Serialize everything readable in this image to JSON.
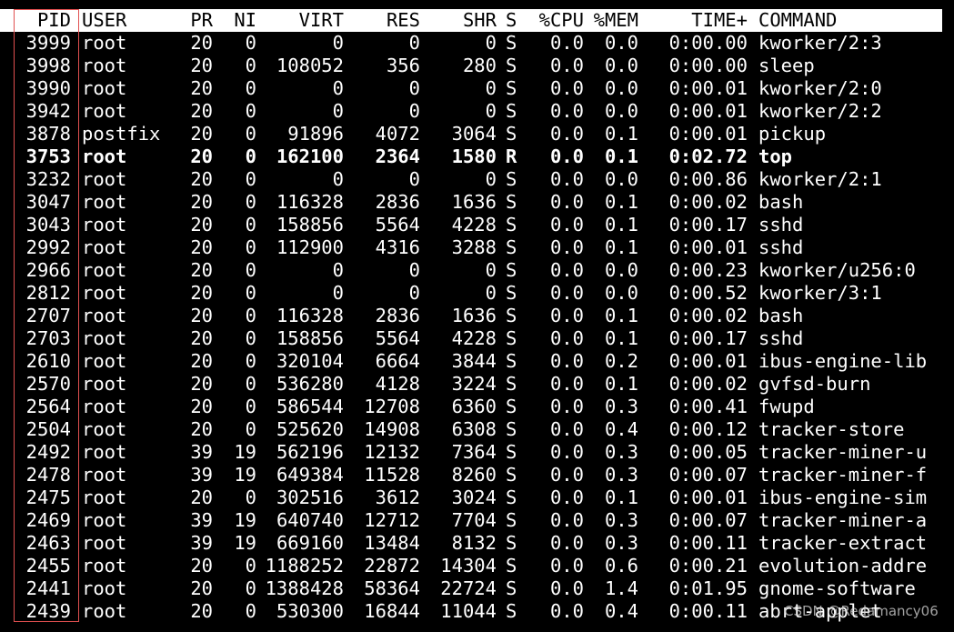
{
  "colors": {
    "background": "#000000",
    "foreground": "#ffffff",
    "header_background": "#ffffff",
    "header_foreground": "#000000",
    "highlight_border": "#e05050"
  },
  "header": {
    "pid": "PID",
    "user": "USER",
    "pr": "PR",
    "ni": "NI",
    "virt": "VIRT",
    "res": "RES",
    "shr": "SHR",
    "s": "S",
    "cpu": "%CPU",
    "mem": "%MEM",
    "time": "TIME+",
    "command": "COMMAND"
  },
  "processes": [
    {
      "pid": "3999",
      "user": "root",
      "pr": "20",
      "ni": "0",
      "virt": "0",
      "res": "0",
      "shr": "0",
      "s": "S",
      "cpu": "0.0",
      "mem": "0.0",
      "time": "0:00.00",
      "command": "kworker/2:3"
    },
    {
      "pid": "3998",
      "user": "root",
      "pr": "20",
      "ni": "0",
      "virt": "108052",
      "res": "356",
      "shr": "280",
      "s": "S",
      "cpu": "0.0",
      "mem": "0.0",
      "time": "0:00.00",
      "command": "sleep"
    },
    {
      "pid": "3990",
      "user": "root",
      "pr": "20",
      "ni": "0",
      "virt": "0",
      "res": "0",
      "shr": "0",
      "s": "S",
      "cpu": "0.0",
      "mem": "0.0",
      "time": "0:00.01",
      "command": "kworker/2:0"
    },
    {
      "pid": "3942",
      "user": "root",
      "pr": "20",
      "ni": "0",
      "virt": "0",
      "res": "0",
      "shr": "0",
      "s": "S",
      "cpu": "0.0",
      "mem": "0.0",
      "time": "0:00.01",
      "command": "kworker/2:2"
    },
    {
      "pid": "3878",
      "user": "postfix",
      "pr": "20",
      "ni": "0",
      "virt": "91896",
      "res": "4072",
      "shr": "3064",
      "s": "S",
      "cpu": "0.0",
      "mem": "0.1",
      "time": "0:00.01",
      "command": "pickup"
    },
    {
      "pid": "3753",
      "user": "root",
      "pr": "20",
      "ni": "0",
      "virt": "162100",
      "res": "2364",
      "shr": "1580",
      "s": "R",
      "cpu": "0.0",
      "mem": "0.1",
      "time": "0:02.72",
      "command": "top",
      "bold": true
    },
    {
      "pid": "3232",
      "user": "root",
      "pr": "20",
      "ni": "0",
      "virt": "0",
      "res": "0",
      "shr": "0",
      "s": "S",
      "cpu": "0.0",
      "mem": "0.0",
      "time": "0:00.86",
      "command": "kworker/2:1"
    },
    {
      "pid": "3047",
      "user": "root",
      "pr": "20",
      "ni": "0",
      "virt": "116328",
      "res": "2836",
      "shr": "1636",
      "s": "S",
      "cpu": "0.0",
      "mem": "0.1",
      "time": "0:00.02",
      "command": "bash"
    },
    {
      "pid": "3043",
      "user": "root",
      "pr": "20",
      "ni": "0",
      "virt": "158856",
      "res": "5564",
      "shr": "4228",
      "s": "S",
      "cpu": "0.0",
      "mem": "0.1",
      "time": "0:00.17",
      "command": "sshd"
    },
    {
      "pid": "2992",
      "user": "root",
      "pr": "20",
      "ni": "0",
      "virt": "112900",
      "res": "4316",
      "shr": "3288",
      "s": "S",
      "cpu": "0.0",
      "mem": "0.1",
      "time": "0:00.01",
      "command": "sshd"
    },
    {
      "pid": "2966",
      "user": "root",
      "pr": "20",
      "ni": "0",
      "virt": "0",
      "res": "0",
      "shr": "0",
      "s": "S",
      "cpu": "0.0",
      "mem": "0.0",
      "time": "0:00.23",
      "command": "kworker/u256:0"
    },
    {
      "pid": "2812",
      "user": "root",
      "pr": "20",
      "ni": "0",
      "virt": "0",
      "res": "0",
      "shr": "0",
      "s": "S",
      "cpu": "0.0",
      "mem": "0.0",
      "time": "0:00.52",
      "command": "kworker/3:1"
    },
    {
      "pid": "2707",
      "user": "root",
      "pr": "20",
      "ni": "0",
      "virt": "116328",
      "res": "2836",
      "shr": "1636",
      "s": "S",
      "cpu": "0.0",
      "mem": "0.1",
      "time": "0:00.02",
      "command": "bash"
    },
    {
      "pid": "2703",
      "user": "root",
      "pr": "20",
      "ni": "0",
      "virt": "158856",
      "res": "5564",
      "shr": "4228",
      "s": "S",
      "cpu": "0.0",
      "mem": "0.1",
      "time": "0:00.17",
      "command": "sshd"
    },
    {
      "pid": "2610",
      "user": "root",
      "pr": "20",
      "ni": "0",
      "virt": "320104",
      "res": "6664",
      "shr": "3844",
      "s": "S",
      "cpu": "0.0",
      "mem": "0.2",
      "time": "0:00.01",
      "command": "ibus-engine-lib"
    },
    {
      "pid": "2570",
      "user": "root",
      "pr": "20",
      "ni": "0",
      "virt": "536280",
      "res": "4128",
      "shr": "3224",
      "s": "S",
      "cpu": "0.0",
      "mem": "0.1",
      "time": "0:00.02",
      "command": "gvfsd-burn"
    },
    {
      "pid": "2564",
      "user": "root",
      "pr": "20",
      "ni": "0",
      "virt": "586544",
      "res": "12708",
      "shr": "6360",
      "s": "S",
      "cpu": "0.0",
      "mem": "0.3",
      "time": "0:00.41",
      "command": "fwupd"
    },
    {
      "pid": "2504",
      "user": "root",
      "pr": "20",
      "ni": "0",
      "virt": "525620",
      "res": "14908",
      "shr": "6308",
      "s": "S",
      "cpu": "0.0",
      "mem": "0.4",
      "time": "0:00.12",
      "command": "tracker-store"
    },
    {
      "pid": "2492",
      "user": "root",
      "pr": "39",
      "ni": "19",
      "virt": "562196",
      "res": "12132",
      "shr": "7364",
      "s": "S",
      "cpu": "0.0",
      "mem": "0.3",
      "time": "0:00.05",
      "command": "tracker-miner-u"
    },
    {
      "pid": "2478",
      "user": "root",
      "pr": "39",
      "ni": "19",
      "virt": "649384",
      "res": "11528",
      "shr": "8260",
      "s": "S",
      "cpu": "0.0",
      "mem": "0.3",
      "time": "0:00.07",
      "command": "tracker-miner-f"
    },
    {
      "pid": "2475",
      "user": "root",
      "pr": "20",
      "ni": "0",
      "virt": "302516",
      "res": "3612",
      "shr": "3024",
      "s": "S",
      "cpu": "0.0",
      "mem": "0.1",
      "time": "0:00.01",
      "command": "ibus-engine-sim"
    },
    {
      "pid": "2469",
      "user": "root",
      "pr": "39",
      "ni": "19",
      "virt": "640740",
      "res": "12712",
      "shr": "7704",
      "s": "S",
      "cpu": "0.0",
      "mem": "0.3",
      "time": "0:00.07",
      "command": "tracker-miner-a"
    },
    {
      "pid": "2463",
      "user": "root",
      "pr": "39",
      "ni": "19",
      "virt": "669160",
      "res": "13484",
      "shr": "8132",
      "s": "S",
      "cpu": "0.0",
      "mem": "0.3",
      "time": "0:00.11",
      "command": "tracker-extract"
    },
    {
      "pid": "2455",
      "user": "root",
      "pr": "20",
      "ni": "0",
      "virt": "1188252",
      "res": "22872",
      "shr": "14304",
      "s": "S",
      "cpu": "0.0",
      "mem": "0.6",
      "time": "0:00.21",
      "command": "evolution-addre"
    },
    {
      "pid": "2441",
      "user": "root",
      "pr": "20",
      "ni": "0",
      "virt": "1388428",
      "res": "58364",
      "shr": "22724",
      "s": "S",
      "cpu": "0.0",
      "mem": "1.4",
      "time": "0:01.95",
      "command": "gnome-software"
    },
    {
      "pid": "2439",
      "user": "root",
      "pr": "20",
      "ni": "0",
      "virt": "530300",
      "res": "16844",
      "shr": "11044",
      "s": "S",
      "cpu": "0.0",
      "mem": "0.4",
      "time": "0:00.11",
      "command": "abrt-applet"
    }
  ],
  "watermark": "CSDN @Redamancy06"
}
